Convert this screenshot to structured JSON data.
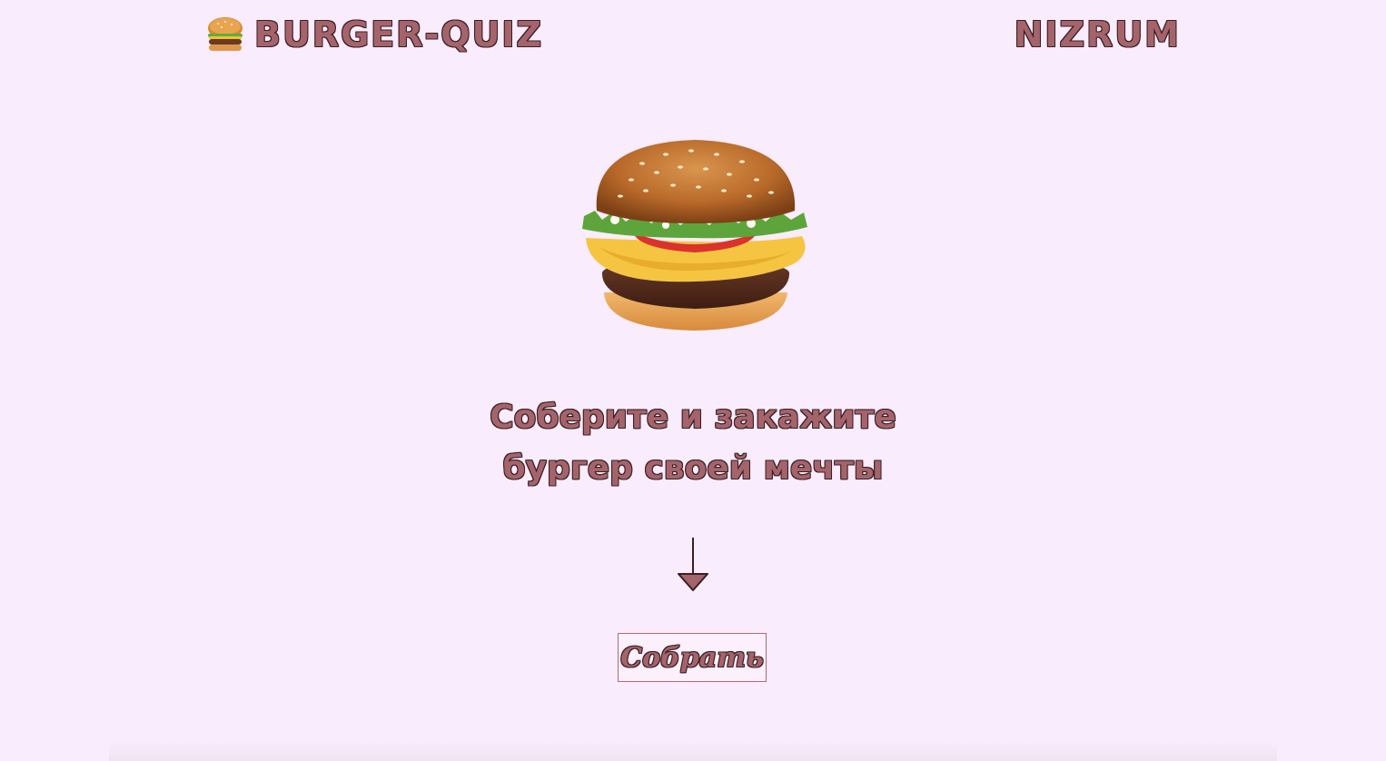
{
  "header": {
    "logo_text": "BURGER-QUIZ",
    "logo_icon": "burger-icon",
    "brand_text": "NIZRUM"
  },
  "hero": {
    "image": "burger-image",
    "headline_line1": "Соберите и закажите",
    "headline_line2": "бургер своей мечты",
    "arrow_icon": "arrow-down-icon"
  },
  "cta": {
    "label": "Собрать"
  },
  "colors": {
    "background": "#f9ecfc",
    "accent": "#a5646c",
    "outline": "#3a1f22"
  }
}
